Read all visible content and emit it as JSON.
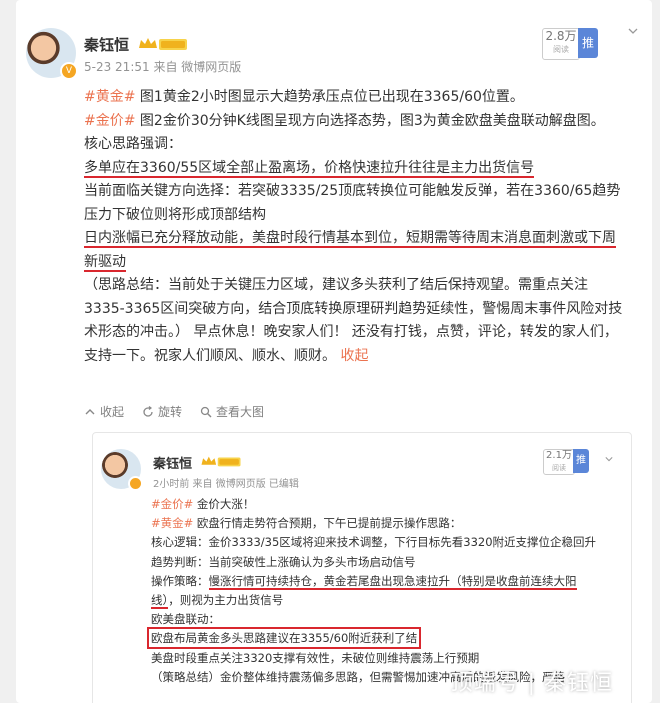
{
  "post": {
    "author": "秦钰恒",
    "meta": "5-23 21:51  来自  微博网页版",
    "read_count": "2.8万",
    "read_sub": "阅读",
    "promote_label": "推广",
    "paragraphs": {
      "p1_tag": "#黄金#",
      "p1_text": " 图1黄金2小时图显示大趋势承压点位已出现在3365/60位置。",
      "p2_tag": "#金价#",
      "p2_text": " 图2金价30分钟K线图呈现方向选择态势，图3为黄金欧盘美盘联动解盘图。",
      "p3": "核心思路强调：",
      "p4": "多单应在3360/55区域全部止盈离场，价格快速拉升往往是主力出货信号",
      "p5": "当前面临关键方向选择：若突破3335/25顶底转换位可能触发反弹，若在3360/65趋势压力下破位则将形成顶部结构",
      "p6": "日内涨幅已充分释放动能，美盘时段行情基本到位，短期需等待周末消息面刺激或下周新驱动",
      "p7": "（思路总结：当前处于关键压力区域，建议多头获利了结后保持观望。需重点关注3335-3365区间突破方向，结合顶底转换原理研判趋势延续性，警惕周末事件风险对技术形态的冲击。）  早点休息！晚安家人们！  还没有打钱，点赞，评论，转发的家人们，支持一下。祝家人们顺风、顺水、顺财。",
      "collapse": "收起"
    },
    "actions": {
      "collapse": "收起",
      "rotate": "旋转",
      "view_large": "查看大图"
    }
  },
  "repost": {
    "author": "秦钰恒",
    "meta": "2小时前  来自  微博网页版  已编辑",
    "read_count": "2.1万",
    "read_sub": "阅读",
    "promote_label": "推广",
    "lines": {
      "l1_tag": "#金价#",
      "l1_text": " 金价大涨！",
      "l2_tag": "#黄金#",
      "l2_text": " 欧盘行情走势符合预期，下午已提前提示操作思路：",
      "l3": "核心逻辑：金价3333/35区域将迎来技术调整，下行目标先看3320附近支撑位企稳回升",
      "l4": "趋势判断：当前突破性上涨确认为多头市场启动信号",
      "l5a": "操作策略：",
      "l5b": "慢涨行情可持续持仓，黄金若尾盘出现急速拉升",
      "l5c": "（特别是收盘前连续大阳线）",
      "l5d": "，则视为主力出货信号",
      "l6": "欧美盘联动：",
      "l7": "欧盘布局黄金多头思路建议在3355/60附近获利了结",
      "l8": "美盘时段重点关注3320支撑有效性，未破位则维持震荡上行预期",
      "l9": "（策略总结）金价整体维持震荡偏多思路，但需警惕加速冲高后的派发风险，严格"
    }
  },
  "watermark": "顶端号 | 秦钰恒",
  "colors": {
    "accent": "#eb7350",
    "underline": "#d9272e",
    "promote": "#5b86d8"
  }
}
